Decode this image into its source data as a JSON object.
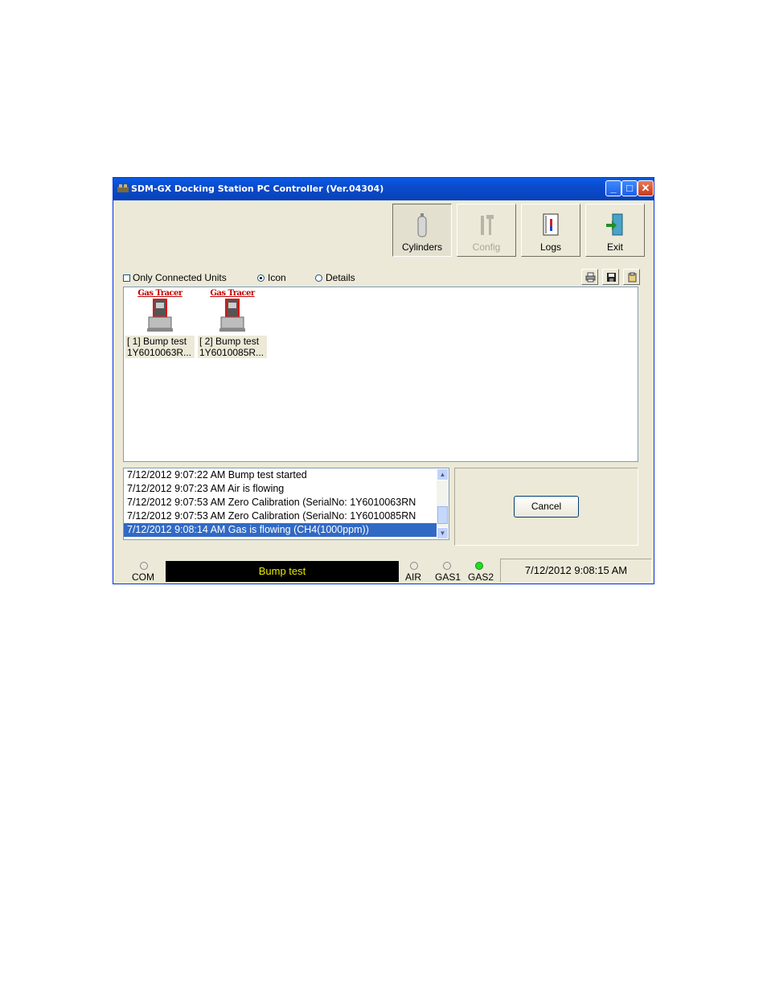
{
  "window": {
    "title": "SDM-GX Docking Station PC Controller (Ver.04304)",
    "minimize": "_",
    "maximize": "□",
    "close": "✕"
  },
  "toolbar": {
    "buttons": [
      {
        "label": "Cylinders",
        "icon": "cylinder-icon",
        "state": "pressed"
      },
      {
        "label": "Config",
        "icon": "tools-icon",
        "state": "disabled"
      },
      {
        "label": "Logs",
        "icon": "notebook-icon",
        "state": "normal"
      },
      {
        "label": "Exit",
        "icon": "exit-door-icon",
        "state": "normal"
      }
    ]
  },
  "options": {
    "only_connected": {
      "label": "Only Connected Units",
      "checked": false
    },
    "view_icon": {
      "label": "Icon",
      "selected": true
    },
    "view_details": {
      "label": "Details",
      "selected": false
    },
    "action_icons": [
      "print-icon",
      "save-icon",
      "clipboard-icon"
    ]
  },
  "units": [
    {
      "logo": "Gas Tracer",
      "line1": "[ 1] Bump test",
      "line2": "1Y6010063R..."
    },
    {
      "logo": "Gas Tracer",
      "line1": "[ 2] Bump test",
      "line2": "1Y6010085R..."
    }
  ],
  "log": {
    "lines": [
      "7/12/2012 9:07:22 AM Bump test started",
      "7/12/2012 9:07:23 AM Air is flowing",
      "7/12/2012 9:07:53 AM Zero Calibration (SerialNo: 1Y6010063RN",
      "7/12/2012 9:07:53 AM Zero Calibration (SerialNo: 1Y6010085RN",
      "7/12/2012 9:08:14 AM Gas is flowing (CH4(1000ppm))"
    ],
    "selected_index": 4
  },
  "cancel_label": "Cancel",
  "status": {
    "com_label": "COM",
    "display_text": "Bump test",
    "air_label": "AIR",
    "gas1_label": "GAS1",
    "gas2_label": "GAS2",
    "gas2_on": true,
    "datetime": "7/12/2012 9:08:15 AM",
    "display_color": "#e8e800",
    "led_on_color": "#22dd22"
  }
}
